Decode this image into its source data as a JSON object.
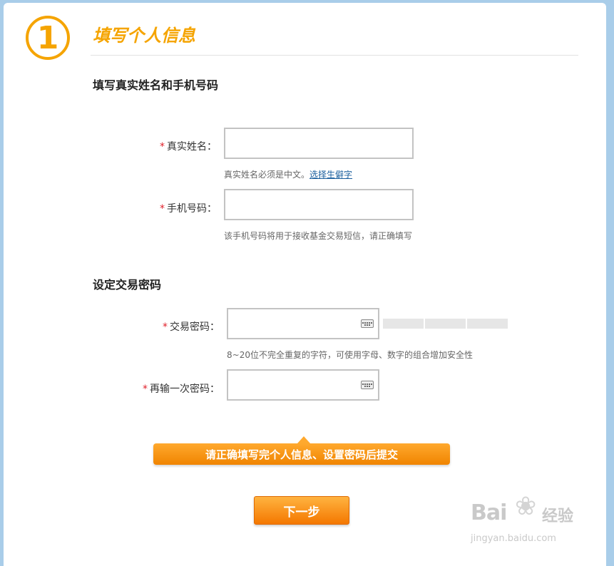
{
  "step": {
    "number": "1",
    "title": "填写个人信息"
  },
  "sections": {
    "identity_heading": "填写真实姓名和手机号码",
    "password_heading": "设定交易密码"
  },
  "fields": {
    "real_name": {
      "required_mark": "*",
      "label": "真实姓名：",
      "value": "",
      "hint": "真实姓名必须是中文。",
      "hint_link": "选择生僻字"
    },
    "phone": {
      "required_mark": "*",
      "label": "手机号码：",
      "value": "",
      "hint": "该手机号码将用于接收基金交易短信，请正确填写"
    },
    "trade_password": {
      "required_mark": "*",
      "label": "交易密码：",
      "value": "",
      "hint": "8~20位不完全重复的字符，可使用字母、数字的组合增加安全性"
    },
    "confirm_password": {
      "required_mark": "*",
      "label": "再输一次密码：",
      "value": ""
    }
  },
  "tip": "请正确填写完个人信息、设置密码后提交",
  "next_button": "下一步",
  "watermark": {
    "logo": "Bai",
    "logo_cn": "经验",
    "url": "jingyan.baidu.com"
  },
  "colors": {
    "accent": "#f5a400",
    "button": "#f47800",
    "required": "#e0202a",
    "link": "#1a5f9e"
  }
}
